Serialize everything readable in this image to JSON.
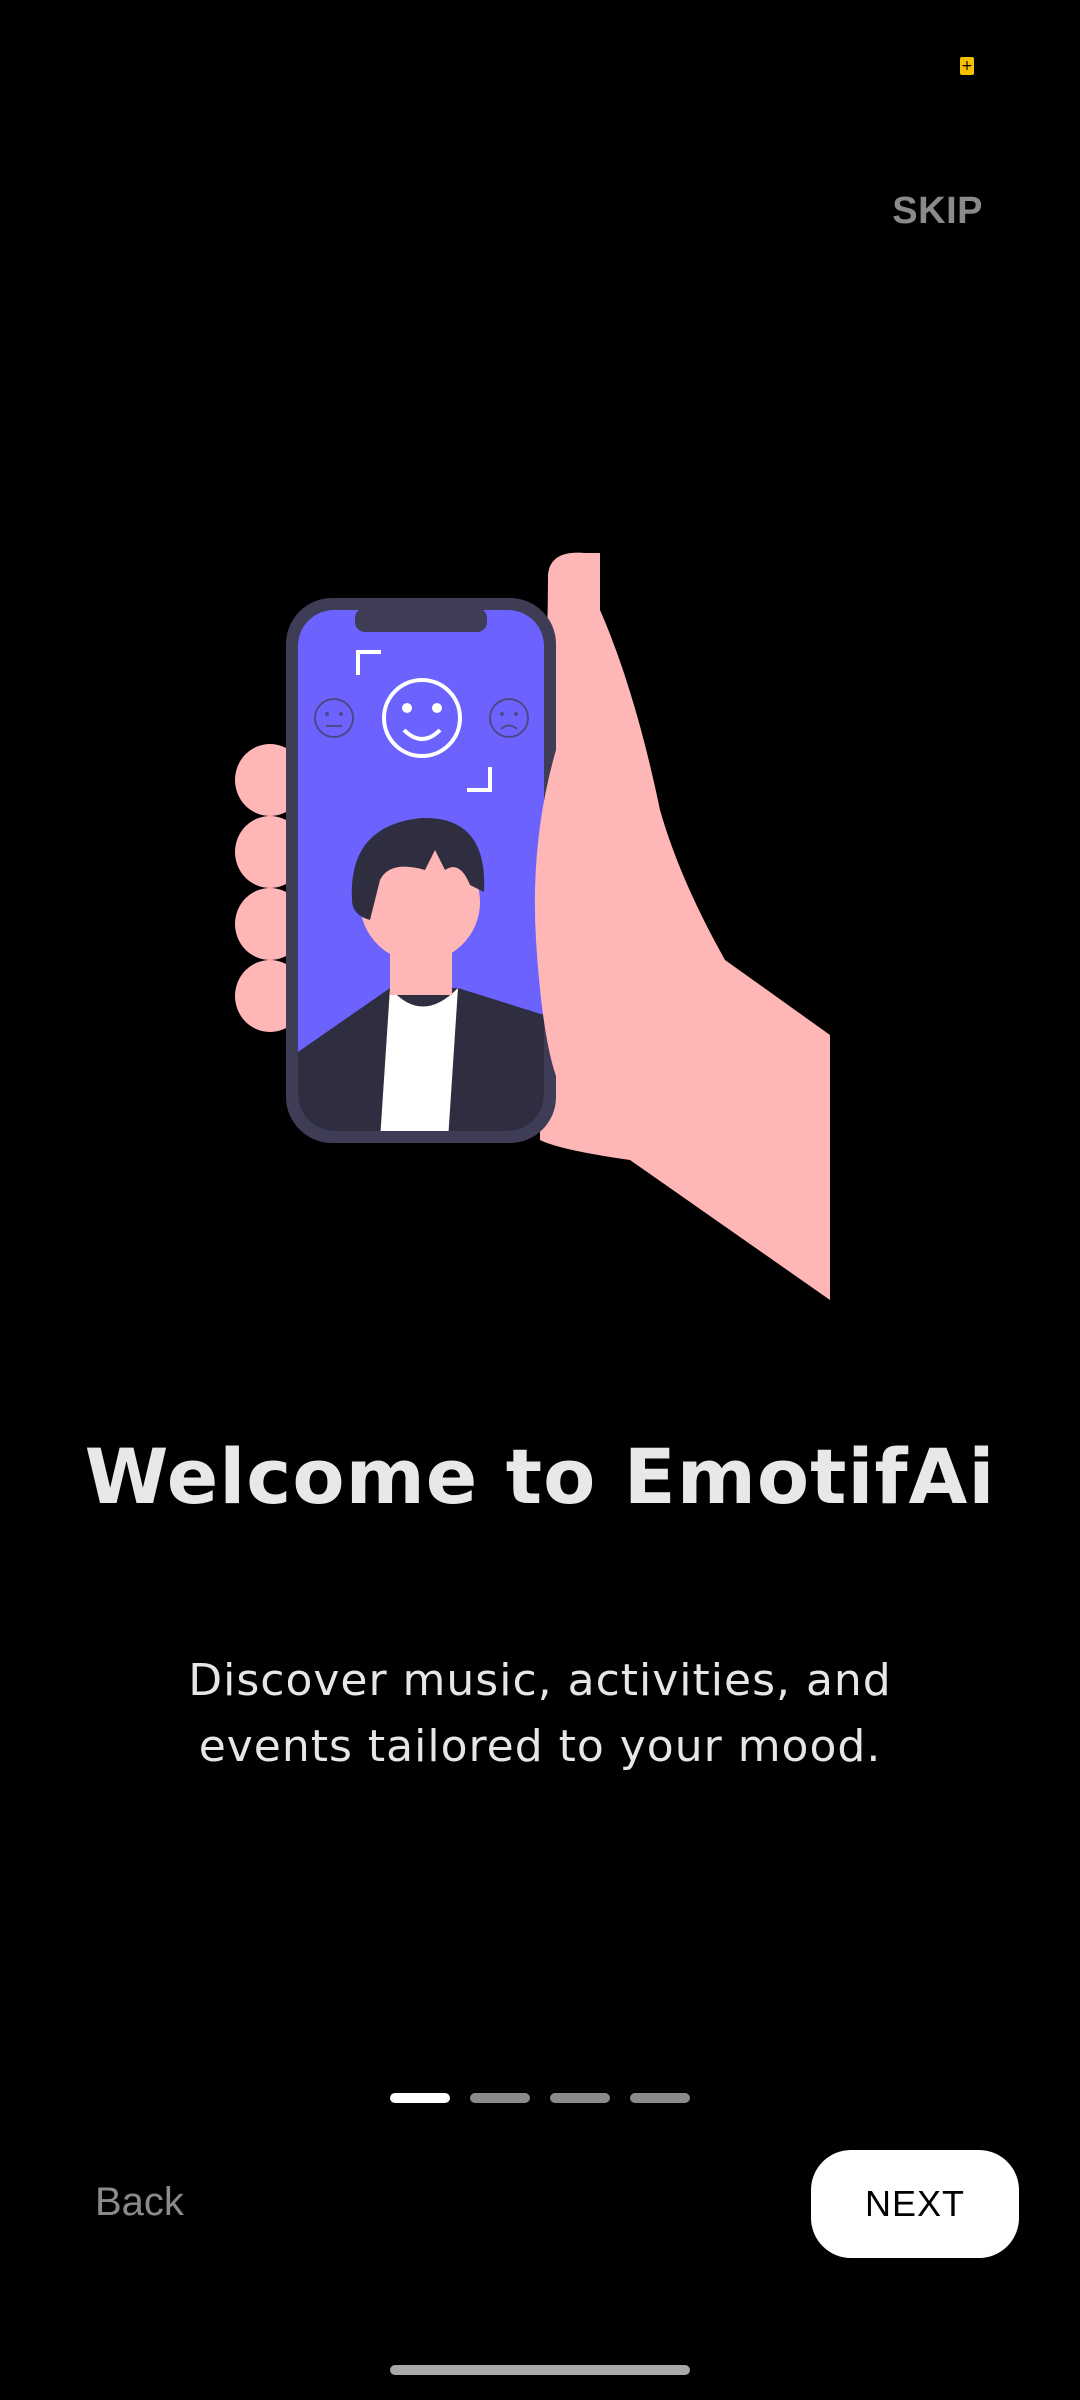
{
  "status_bar": {
    "icon": "battery-saver-icon",
    "icon_glyph": "+"
  },
  "onboarding": {
    "skip_label": "SKIP",
    "title": "Welcome to EmotifAi",
    "subtitle": "Discover music, activities, and events tailored to your mood.",
    "page_count": 4,
    "active_page": 1,
    "back_label": "Back",
    "next_label": "NEXT"
  },
  "colors": {
    "background": "#000000",
    "phone_screen": "#6c63ff",
    "hand": "#ffb6b6",
    "phone_frame": "#3f3d56",
    "jacket": "#2f2e41",
    "muted_text": "#8a8a8a"
  }
}
